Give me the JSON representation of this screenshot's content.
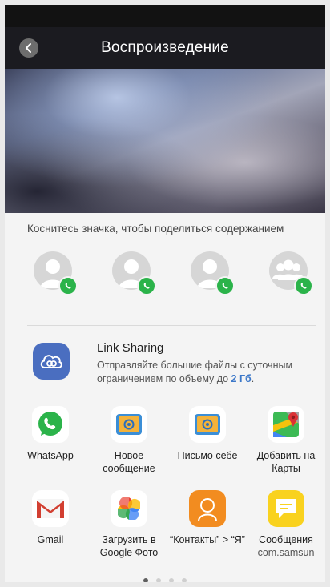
{
  "header": {
    "title": "Воспроизведение"
  },
  "share_sheet": {
    "hint": "Коснитесь значка, чтобы поделиться содержанием",
    "contacts": [
      {
        "icon": "person-avatar-icon",
        "badge": "whatsapp-icon"
      },
      {
        "icon": "person-avatar-icon",
        "badge": "whatsapp-icon"
      },
      {
        "icon": "person-avatar-icon",
        "badge": "whatsapp-icon"
      },
      {
        "icon": "group-avatar-icon",
        "badge": "whatsapp-icon"
      }
    ],
    "link_sharing": {
      "title": "Link Sharing",
      "description": "Отправляйте большие файлы с суточным ограничением по объему до",
      "limit": "2 Гб",
      "suffix": "."
    },
    "apps": [
      {
        "label": "WhatsApp",
        "icon": "whatsapp-icon",
        "color": "#ffffff"
      },
      {
        "label": "Новое сообщение",
        "icon": "email-at-icon",
        "color": "#ffffff"
      },
      {
        "label": "Письмо себе",
        "icon": "email-at-icon",
        "color": "#ffffff"
      },
      {
        "label": "Добавить на Карты",
        "icon": "google-maps-icon",
        "color": "#ffffff"
      },
      {
        "label": "Gmail",
        "icon": "gmail-icon",
        "color": "#ffffff"
      },
      {
        "label": "Загрузить в Google Фото",
        "icon": "google-photos-icon",
        "color": "#ffffff"
      },
      {
        "label": "“Контакты” > “Я”",
        "icon": "contacts-me-icon",
        "color": "#f28c20"
      },
      {
        "label": "Сообщения",
        "sublabel": "com.samsun",
        "icon": "messages-icon",
        "color": "#f9d21f"
      }
    ],
    "page_dots": {
      "count": 4,
      "active": 1
    }
  }
}
